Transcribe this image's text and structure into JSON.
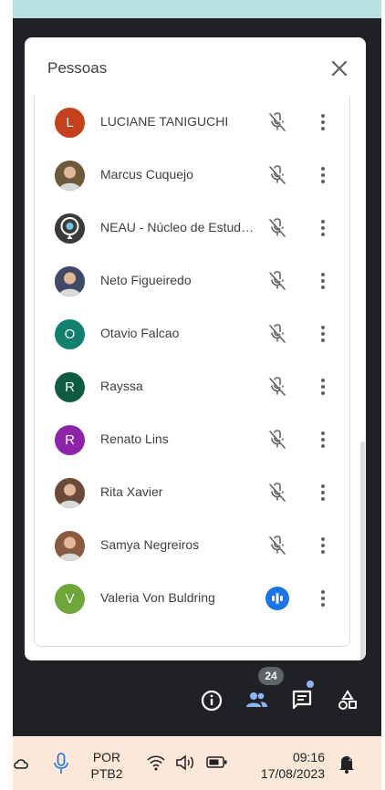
{
  "panel": {
    "title": "Pessoas",
    "participants": [
      {
        "name": "LUCIANE TANIGUCHI",
        "initial": "L",
        "color": "#c5401d",
        "avatar": "letter",
        "mic": "muted"
      },
      {
        "name": "Marcus Cuquejo",
        "initial": "",
        "color": "#6d5a3c",
        "avatar": "photo",
        "mic": "muted"
      },
      {
        "name": "NEAU - Núcleo de Estudos...",
        "initial": "",
        "color": "#3a3a3a",
        "avatar": "logo",
        "mic": "muted"
      },
      {
        "name": "Neto Figueiredo",
        "initial": "",
        "color": "#3e4a66",
        "avatar": "photo",
        "mic": "muted"
      },
      {
        "name": "Otavio Falcao",
        "initial": "O",
        "color": "#12806f",
        "avatar": "letter",
        "mic": "muted"
      },
      {
        "name": "Rayssa",
        "initial": "R",
        "color": "#0d5b43",
        "avatar": "letter",
        "mic": "muted"
      },
      {
        "name": "Renato Lins",
        "initial": "R",
        "color": "#8e24aa",
        "avatar": "letter",
        "mic": "muted"
      },
      {
        "name": "Rita Xavier",
        "initial": "",
        "color": "#6b4a3a",
        "avatar": "photo",
        "mic": "muted"
      },
      {
        "name": "Samya Negreiros",
        "initial": "",
        "color": "#8a5a40",
        "avatar": "photo",
        "mic": "muted"
      },
      {
        "name": "Valeria Von Buldring",
        "initial": "V",
        "color": "#6ea63a",
        "avatar": "letter",
        "mic": "speaking"
      }
    ]
  },
  "toolbar": {
    "people_count": "24",
    "icons": [
      "info-icon",
      "people-icon",
      "chat-icon",
      "activities-icon"
    ]
  },
  "taskbar": {
    "lang_1": "POR",
    "lang_2": "PTB2",
    "time": "09:16",
    "date": "17/08/2023"
  },
  "colors": {
    "accent": "#1a73e8",
    "dark_bg": "#202124",
    "taskbar_bg": "#fce8d8"
  }
}
